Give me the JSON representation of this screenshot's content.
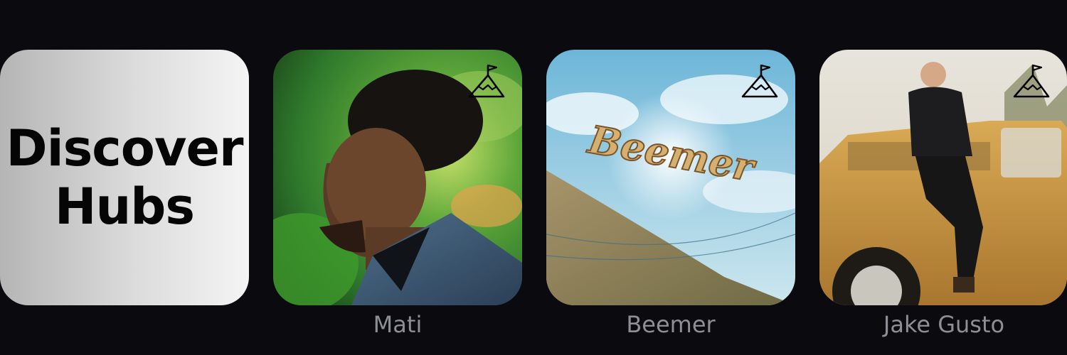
{
  "discover": {
    "line1": "Discover",
    "line2": "Hubs"
  },
  "hubs": [
    {
      "name": "Mati",
      "badge_icon": "summit-flag-icon"
    },
    {
      "name": "Beemer",
      "badge_icon": "summit-flag-icon",
      "artwork_text": "Beemer"
    },
    {
      "name": "Jake Gusto",
      "badge_icon": "summit-flag-icon"
    }
  ],
  "colors": {
    "background": "#0b0a0f",
    "label": "#8e8e96",
    "discover_text": "#050505"
  }
}
